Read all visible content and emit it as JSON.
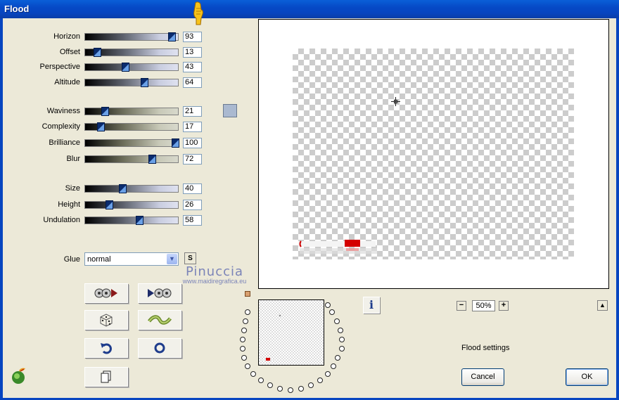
{
  "window": {
    "title": "Flood"
  },
  "sliders": [
    {
      "label": "Horizon",
      "value": "93",
      "level": 93,
      "style": "blue"
    },
    {
      "label": "Offset",
      "value": "13",
      "level": 13,
      "style": "blue"
    },
    {
      "label": "Perspective",
      "value": "43",
      "level": 43,
      "style": "blue"
    },
    {
      "label": "Altitude",
      "value": "64",
      "level": 64,
      "style": "blue"
    },
    {
      "label": "Waviness",
      "value": "21",
      "level": 21,
      "style": "olive"
    },
    {
      "label": "Complexity",
      "value": "17",
      "level": 17,
      "style": "olive"
    },
    {
      "label": "Brilliance",
      "value": "100",
      "level": 100,
      "style": "olive"
    },
    {
      "label": "Blur",
      "value": "72",
      "level": 72,
      "style": "olive"
    },
    {
      "label": "Size",
      "value": "40",
      "level": 40,
      "style": "blue"
    },
    {
      "label": "Height",
      "value": "26",
      "level": 26,
      "style": "blue"
    },
    {
      "label": "Undulation",
      "value": "58",
      "level": 58,
      "style": "blue"
    }
  ],
  "color_swatch": "#aab9d0",
  "glue": {
    "label": "Glue",
    "value": "normal",
    "s_label": "S"
  },
  "watermark": {
    "line1": "Pinuccia",
    "line2": "www.maidiregrafica.eu"
  },
  "icon_buttons": [
    {
      "name": "load-preset-icon"
    },
    {
      "name": "save-preset-icon"
    },
    {
      "name": "randomize-dice-icon"
    },
    {
      "name": "wave-preset-icon"
    },
    {
      "name": "reset-undo-icon"
    },
    {
      "name": "default-circle-icon"
    },
    {
      "name": "copy-icon"
    }
  ],
  "zoom": {
    "value": "50%",
    "minus": "−",
    "plus": "+"
  },
  "status": {
    "settings": "Flood settings"
  },
  "buttons": {
    "cancel": "Cancel",
    "ok": "OK"
  },
  "info_label": "i"
}
